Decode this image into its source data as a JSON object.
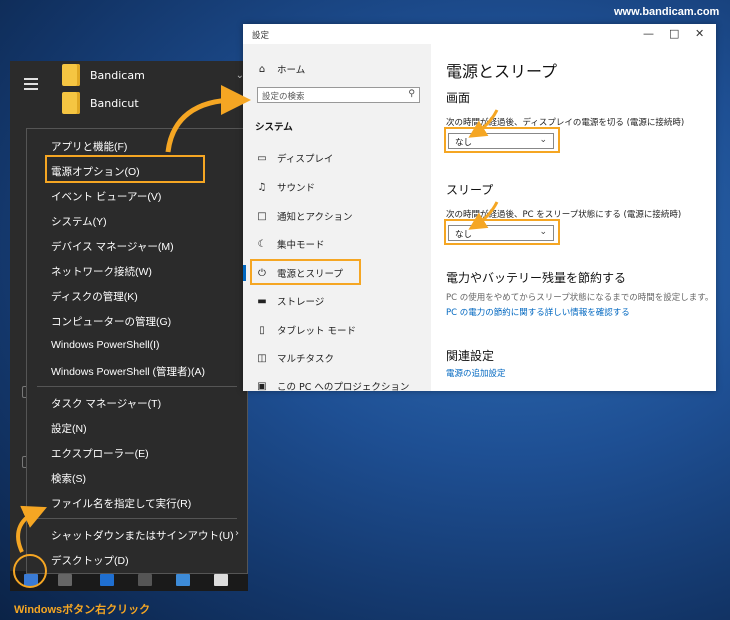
{
  "watermark": "www.bandicam.com",
  "start_menu": {
    "apps": [
      {
        "label": "Bandicam",
        "icon": "folder-icon"
      },
      {
        "label": "Bandicut",
        "icon": "folder-icon"
      }
    ]
  },
  "context_menu": {
    "groups": [
      [
        "アプリと機能(F)",
        "電源オプション(O)",
        "イベント ビューアー(V)",
        "システム(Y)",
        "デバイス マネージャー(M)",
        "ネットワーク接続(W)",
        "ディスクの管理(K)",
        "コンピューターの管理(G)",
        "Windows PowerShell(I)",
        "Windows PowerShell (管理者)(A)"
      ],
      [
        "タスク マネージャー(T)",
        "設定(N)",
        "エクスプローラー(E)",
        "検索(S)",
        "ファイル名を指定して実行(R)"
      ],
      [
        "シャットダウンまたはサインアウト(U)",
        "デスクトップ(D)"
      ]
    ]
  },
  "settings": {
    "window_title": "設定",
    "home": "ホーム",
    "search_placeholder": "設定の検索",
    "section": "システム",
    "nav": [
      {
        "label": "ディスプレイ",
        "icon": "display-icon"
      },
      {
        "label": "サウンド",
        "icon": "sound-icon"
      },
      {
        "label": "通知とアクション",
        "icon": "notification-icon"
      },
      {
        "label": "集中モード",
        "icon": "moon-icon"
      },
      {
        "label": "電源とスリープ",
        "icon": "power-icon"
      },
      {
        "label": "ストレージ",
        "icon": "storage-icon"
      },
      {
        "label": "タブレット モード",
        "icon": "tablet-icon"
      },
      {
        "label": "マルチタスク",
        "icon": "multitask-icon"
      },
      {
        "label": "この PC へのプロジェクション",
        "icon": "projection-icon"
      }
    ],
    "page_title": "電源とスリープ",
    "screen": {
      "heading": "画面",
      "desc": "次の時間が経過後、ディスプレイの電源を切る (電源に接続時)",
      "value": "なし"
    },
    "sleep": {
      "heading": "スリープ",
      "desc": "次の時間が経過後、PC をスリープ状態にする (電源に接続時)",
      "value": "なし"
    },
    "save": {
      "heading": "電力やバッテリー残量を節約する",
      "desc": "PC の使用をやめてからスリープ状態になるまでの時間を設定します。",
      "link": "PC の電力の節約に関する詳しい情報を確認する"
    },
    "related": {
      "heading": "関連設定",
      "link": "電源の追加設定"
    }
  },
  "caption": "Windowsボタン右クリック",
  "accent_color": "#f5a623"
}
